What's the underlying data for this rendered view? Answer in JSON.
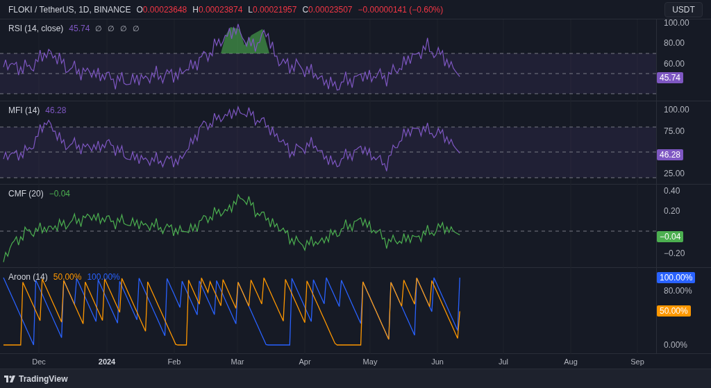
{
  "header": {
    "symbol": "FLOKI / TetherUS, 1D, BINANCE",
    "ohlc": [
      {
        "label": "O",
        "value": "0.00023648"
      },
      {
        "label": "H",
        "value": "0.00023874"
      },
      {
        "label": "L",
        "value": "0.00021957"
      },
      {
        "label": "C",
        "value": "0.00023507"
      }
    ],
    "change": "−0.00000141 (−0.60%)",
    "currency_button": "USDT"
  },
  "panes": [
    {
      "kind": "rsi",
      "title": "RSI (14, close)",
      "readings": [
        {
          "text": "45.74",
          "color": "#7e57c2"
        }
      ],
      "extras": [
        "∅",
        "∅",
        "∅",
        "∅"
      ],
      "axis_labels": [
        "100.00",
        "80.00",
        "60.00"
      ],
      "badges": [
        {
          "text": "45.74",
          "color": "#7e57c2"
        }
      ]
    },
    {
      "kind": "mfi",
      "title": "MFI (14)",
      "readings": [
        {
          "text": "46.28",
          "color": "#7e57c2"
        }
      ],
      "axis_labels": [
        "100.00",
        "75.00",
        "25.00"
      ],
      "badges": [
        {
          "text": "46.28",
          "color": "#7e57c2"
        }
      ]
    },
    {
      "kind": "cmf",
      "title": "CMF (20)",
      "readings": [
        {
          "text": "−0.04",
          "color": "#4caf50"
        }
      ],
      "axis_labels": [
        "0.40",
        "0.20",
        "−0.20"
      ],
      "badges": [
        {
          "text": "−0.04",
          "color": "#4caf50"
        }
      ]
    },
    {
      "kind": "aroon",
      "title": "Aroon (14)",
      "readings": [
        {
          "text": "50.00%",
          "color": "#ff9800"
        },
        {
          "text": "100.00%",
          "color": "#2962ff"
        }
      ],
      "axis_labels": [
        "80.00%",
        "0.00%"
      ],
      "badges": [
        {
          "text": "100.00%",
          "color": "#2962ff"
        },
        {
          "text": "50.00%",
          "color": "#ff9800"
        }
      ]
    }
  ],
  "time_axis": [
    {
      "label": "Dec",
      "bold": false
    },
    {
      "label": "2024",
      "bold": true
    },
    {
      "label": "Feb",
      "bold": false
    },
    {
      "label": "Mar",
      "bold": false
    },
    {
      "label": "Apr",
      "bold": false
    },
    {
      "label": "May",
      "bold": false
    },
    {
      "label": "Jun",
      "bold": false
    },
    {
      "label": "Jul",
      "bold": false
    },
    {
      "label": "Aug",
      "bold": false
    },
    {
      "label": "Sep",
      "bold": false
    }
  ],
  "footer": {
    "brand": "TradingView"
  }
}
